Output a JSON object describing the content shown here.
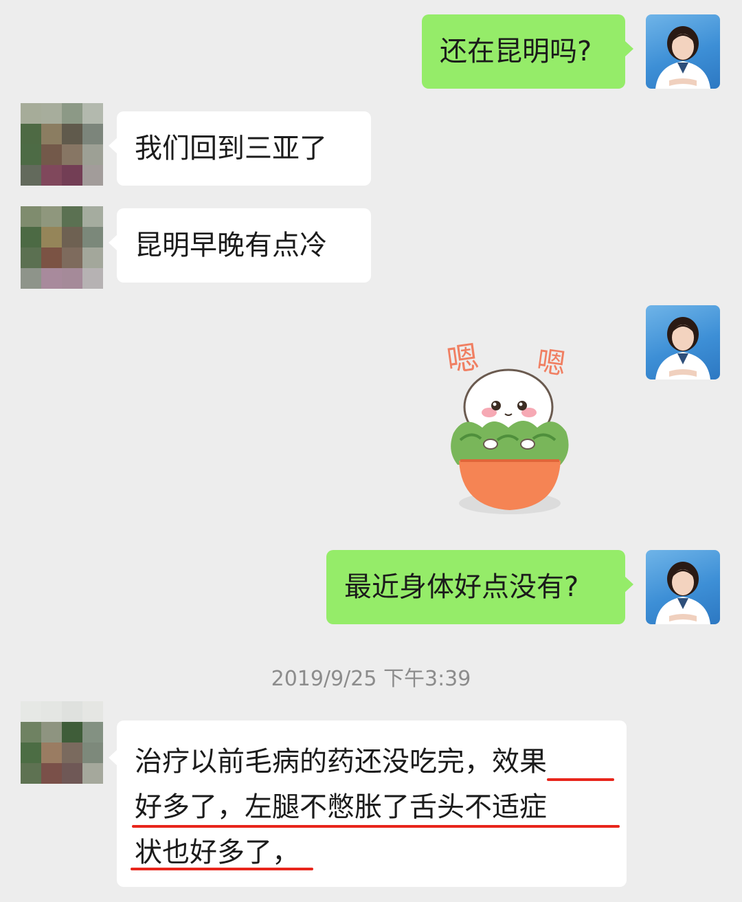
{
  "messages": [
    {
      "side": "me",
      "text": "还在昆明吗?"
    },
    {
      "side": "them",
      "text": "我们回到三亚了"
    },
    {
      "side": "them",
      "text": "昆明早晚有点冷"
    },
    {
      "side": "me",
      "sticker": "嗯 嗯"
    },
    {
      "side": "me",
      "text": "最近身体好点没有?"
    }
  ],
  "timestamp": "2019/9/25 下午3:39",
  "last_message": {
    "side": "them",
    "lines": [
      "治疗以前毛病的药还没吃完，效果",
      "好多了，左腿不憋胀了舌头不适症",
      "状也好多了，"
    ]
  },
  "sticker": {
    "left_char": "嗯",
    "right_char": "嗯"
  },
  "colors": {
    "background": "#ededed",
    "my_bubble": "#95ec69",
    "their_bubble": "#ffffff",
    "underline": "#e8261c"
  }
}
